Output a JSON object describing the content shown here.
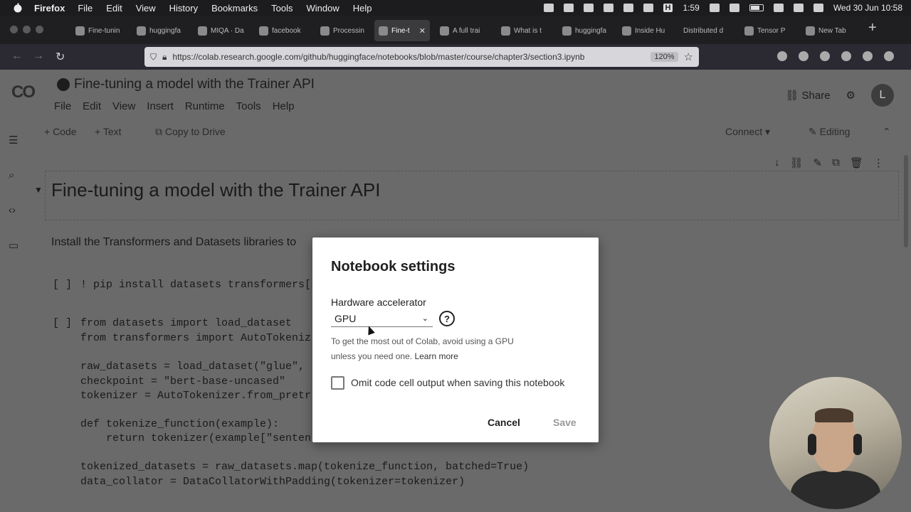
{
  "menubar": {
    "app": "Firefox",
    "items": [
      "File",
      "Edit",
      "View",
      "History",
      "Bookmarks",
      "Tools",
      "Window",
      "Help"
    ],
    "status": {
      "badge": "H",
      "timer": "1:59",
      "datetime": "Wed 30 Jun  10:58"
    }
  },
  "tabs": [
    {
      "label": "Fine-tunin"
    },
    {
      "label": "huggingfa"
    },
    {
      "label": "MIQA · Da"
    },
    {
      "label": "facebook"
    },
    {
      "label": "Processin"
    },
    {
      "label": "Fine-t",
      "active": true
    },
    {
      "label": "A full trai"
    },
    {
      "label": "What is t"
    },
    {
      "label": "huggingfa"
    },
    {
      "label": "Inside Hu"
    },
    {
      "label": "Distributed d"
    },
    {
      "label": "Tensor P"
    },
    {
      "label": "New Tab"
    }
  ],
  "navbar": {
    "url": "https://colab.research.google.com/github/huggingface/notebooks/blob/master/course/chapter3/section3.ipynb",
    "zoom": "120%"
  },
  "colab": {
    "logo": "CO",
    "title": "Fine-tuning a model with the Trainer API",
    "menu": [
      "File",
      "Edit",
      "View",
      "Insert",
      "Runtime",
      "Tools",
      "Help"
    ],
    "share": "Share",
    "avatar": "L",
    "toolbar": {
      "code": "+ Code",
      "text": "+ Text",
      "copy": "Copy to Drive",
      "connect": "Connect",
      "editing": "Editing"
    },
    "heading": "Fine-tuning a model with the Trainer API",
    "intro": "Install the Transformers and Datasets libraries to",
    "cell1": {
      "marker": "[ ]",
      "lines": [
        "! pip install datasets transformers[s"
      ]
    },
    "cell2": {
      "marker": "[ ]",
      "lines": [
        "from datasets import load_dataset",
        "from transformers import AutoTokeniz",
        "",
        "raw_datasets = load_dataset(\"glue\", \"",
        "checkpoint = \"bert-base-uncased\"",
        "tokenizer = AutoTokenizer.from_pretr",
        "",
        "def tokenize_function(example):",
        "    return tokenizer(example[\"senten",
        "",
        "tokenized_datasets = raw_datasets.map(tokenize_function, batched=True)",
        "data_collator = DataCollatorWithPadding(tokenizer=tokenizer)"
      ]
    }
  },
  "dialog": {
    "title": "Notebook settings",
    "hw_label": "Hardware accelerator",
    "hw_value": "GPU",
    "hint": "To get the most out of Colab, avoid using a GPU unless you need one.",
    "learn_more": "Learn more",
    "omit_label": "Omit code cell output when saving this notebook",
    "omit_checked": false,
    "cancel": "Cancel",
    "save": "Save"
  }
}
